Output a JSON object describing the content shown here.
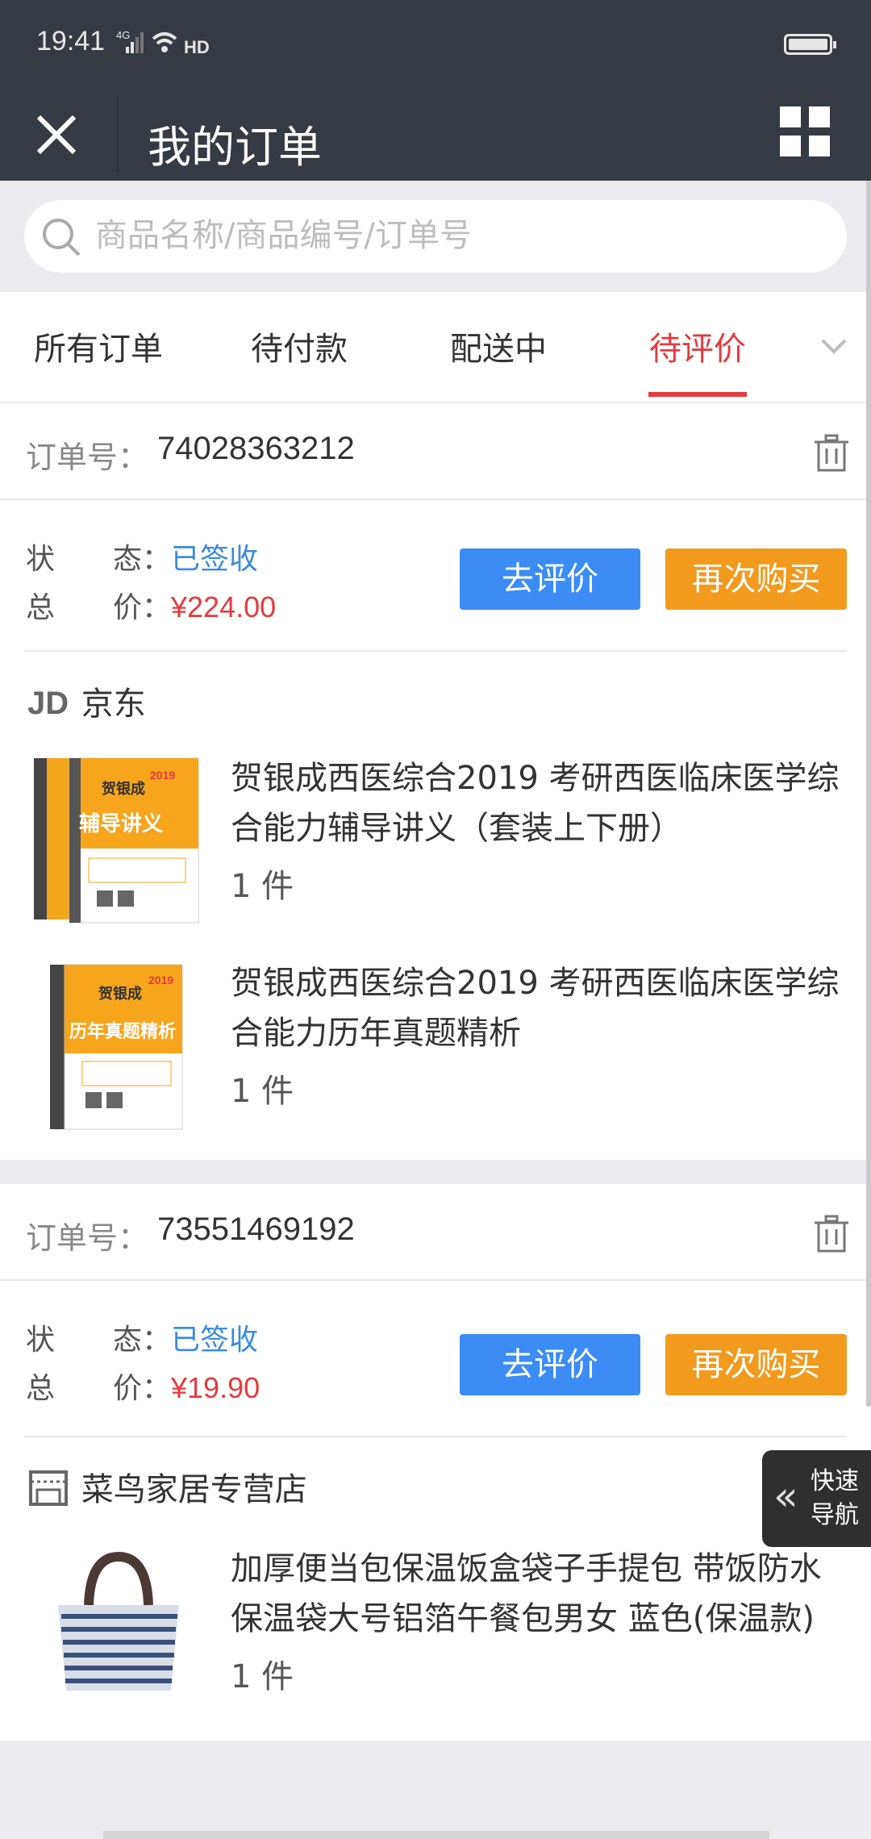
{
  "status_bar": {
    "time": "19:41",
    "network": "4G"
  },
  "header": {
    "title": "我的订单"
  },
  "search": {
    "placeholder": "商品名称/商品编号/订单号"
  },
  "tabs": [
    {
      "label": "所有订单",
      "active": false
    },
    {
      "label": "待付款",
      "active": false
    },
    {
      "label": "配送中",
      "active": false
    },
    {
      "label": "待评价",
      "active": true
    }
  ],
  "orders": [
    {
      "order_label": "订单号：",
      "order_number": "74028363212",
      "status_key": "状　　态：",
      "status_value": "已签收",
      "total_key": "总　　价：",
      "total_value": "¥224.00",
      "review_button": "去评价",
      "rebuy_button": "再次购买",
      "store_name": "京东",
      "store_logo": "JD",
      "items": [
        {
          "title": "贺银成西医综合2019 考研西医临床医学综合能力辅导讲义（套装上下册）",
          "qty": "1 件",
          "cover_text": "辅导讲义",
          "cover_brand": "贺银成",
          "cover_year": "2019"
        },
        {
          "title": "贺银成西医综合2019 考研西医临床医学综合能力历年真题精析",
          "qty": "1 件",
          "cover_text": "历年真题精析",
          "cover_brand": "贺银成",
          "cover_year": "2019"
        }
      ]
    },
    {
      "order_label": "订单号：",
      "order_number": "73551469192",
      "status_key": "状　　态：",
      "status_value": "已签收",
      "total_key": "总　　价：",
      "total_value": "¥19.90",
      "review_button": "去评价",
      "rebuy_button": "再次购买",
      "store_name": "菜鸟家居专营店",
      "items": [
        {
          "title": "加厚便当包保温饭盒袋子手提包 带饭防水保温袋大号铝箔午餐包男女 蓝色(保温款)",
          "qty": "1 件"
        }
      ]
    }
  ],
  "quick_nav": {
    "line1": "快速",
    "line2": "导航"
  },
  "colors": {
    "header_bg": "#363a42",
    "accent_red": "#e33b3f",
    "link_blue": "#3a8be0",
    "button_blue": "#3b8cf5",
    "button_orange": "#f29a1d"
  }
}
